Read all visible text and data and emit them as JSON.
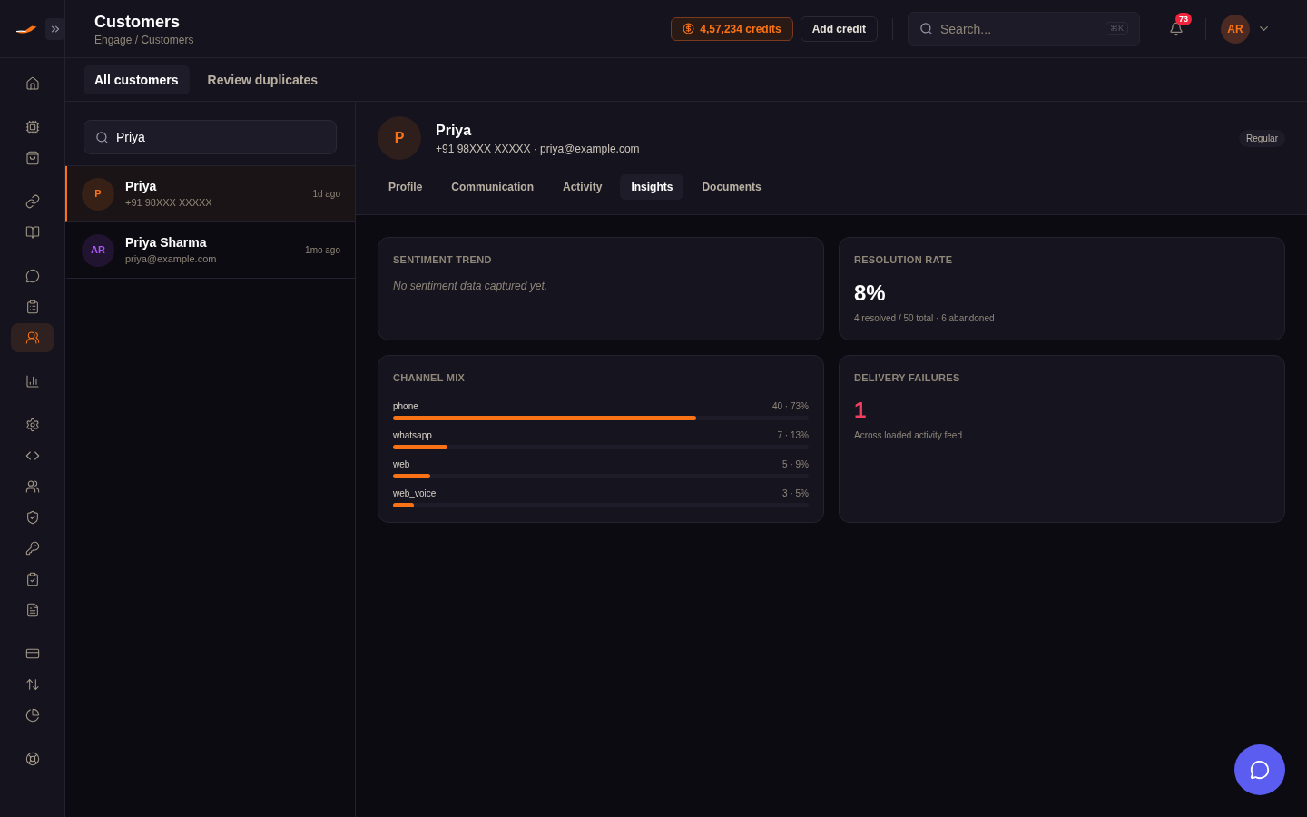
{
  "header": {
    "title": "Customers",
    "breadcrumb": "Engage / Customers",
    "credits": "4,57,234 credits",
    "add_credit": "Add credit",
    "search": {
      "placeholder": "Search...",
      "shortcut": "⌘K"
    },
    "notifications": "73",
    "user_initials": "AR"
  },
  "sidebar": {
    "groups": [
      [
        {
          "selected": false
        }
      ],
      [
        {
          "selected": false
        },
        {
          "selected": false
        }
      ],
      [
        {
          "selected": false
        },
        {
          "selected": false
        }
      ],
      [
        {
          "selected": false
        },
        {
          "selected": false
        },
        {
          "selected": true
        }
      ],
      [
        {
          "selected": false
        }
      ],
      [
        {
          "selected": false
        },
        {
          "selected": false
        },
        {
          "selected": false
        },
        {
          "selected": false
        },
        {
          "selected": false
        },
        {
          "selected": false
        },
        {
          "selected": false
        }
      ],
      [
        {
          "selected": false
        },
        {
          "selected": false
        },
        {
          "selected": false
        }
      ],
      [
        {
          "selected": false
        }
      ]
    ]
  },
  "view_tabs": [
    {
      "label": "All customers",
      "selected": true
    },
    {
      "label": "Review duplicates",
      "selected": false
    }
  ],
  "list_search": {
    "value": "Priya"
  },
  "customers": [
    {
      "initials": "P",
      "name": "Priya",
      "detail": "+91 98XXX XXXXX",
      "time": "1d ago",
      "selected": true,
      "color": "#f97316"
    },
    {
      "initials": "AR",
      "name": "Priya Sharma",
      "detail": "priya@example.com",
      "time": "1mo ago",
      "selected": false,
      "color": "#a855f7"
    }
  ],
  "detail": {
    "initials": "P",
    "name": "Priya",
    "contact": "+91 98XXX XXXXX · priya@example.com",
    "segment": "Regular",
    "tabs": [
      {
        "label": "Profile",
        "selected": false
      },
      {
        "label": "Communication",
        "selected": false
      },
      {
        "label": "Activity",
        "selected": false
      },
      {
        "label": "Insights",
        "selected": true
      },
      {
        "label": "Documents",
        "selected": false
      }
    ]
  },
  "cards": [
    {
      "kind": "empty",
      "title": "SENTIMENT TREND",
      "text": "No sentiment data captured yet."
    },
    {
      "kind": "stat",
      "title": "RESOLUTION RATE",
      "value": "8%",
      "note": "4 resolved / 50 total · 6 abandoned",
      "alert": false
    },
    {
      "kind": "bars",
      "title": "CHANNEL MIX",
      "rows": [
        {
          "label": "phone",
          "reading": "40 · 73%",
          "level": 0.73
        },
        {
          "label": "whatsapp",
          "reading": "7 · 13%",
          "level": 0.13
        },
        {
          "label": "web",
          "reading": "5 · 9%",
          "level": 0.09
        },
        {
          "label": "web_voice",
          "reading": "3 · 5%",
          "level": 0.05
        }
      ]
    },
    {
      "kind": "stat",
      "title": "DELIVERY FAILURES",
      "value": "1",
      "note": "Across loaded activity feed",
      "alert": true
    }
  ]
}
